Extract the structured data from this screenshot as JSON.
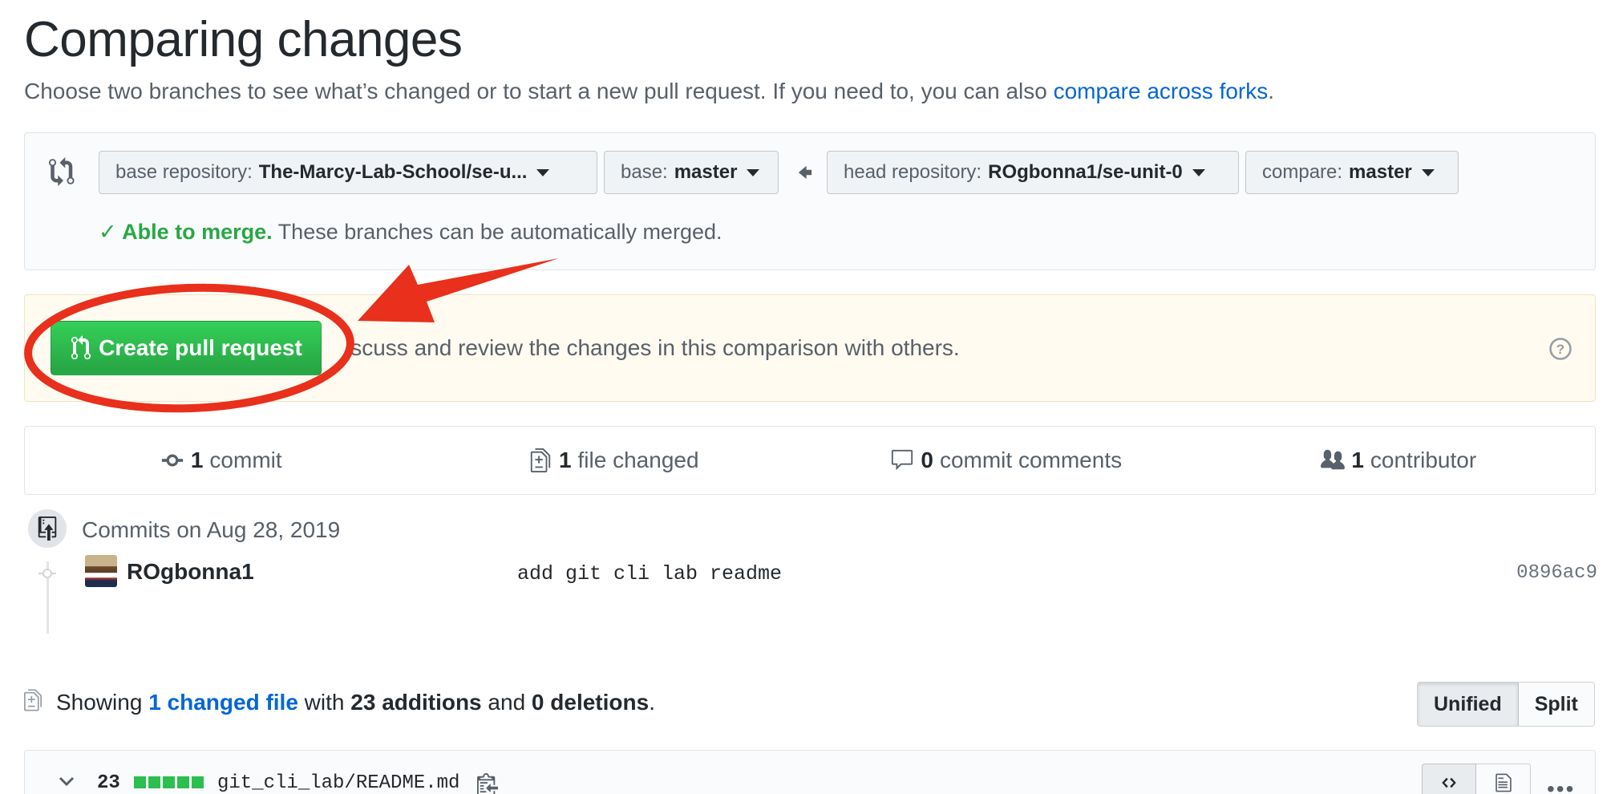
{
  "page": {
    "title": "Comparing changes",
    "subtitle_text": "Choose two branches to see what’s changed or to start a new pull request. If you need to, you can also ",
    "subtitle_link": "compare across forks",
    "subtitle_end": "."
  },
  "range": {
    "base_repo_label": "base repository:",
    "base_repo_value": "The-Marcy-Lab-School/se-u...",
    "base_label": "base:",
    "base_value": "master",
    "head_repo_label": "head repository:",
    "head_repo_value": "ROgbonna1/se-unit-0",
    "compare_label": "compare:",
    "compare_value": "master",
    "merge_ok": "Able to merge.",
    "merge_text": " These branches can be automatically merged."
  },
  "banner": {
    "button_label": "Create pull request",
    "text": "iscuss and review the changes in this comparison with others."
  },
  "summary": {
    "commits_count": "1",
    "commits_label": "commit",
    "files_count": "1",
    "files_label": "file changed",
    "comments_count": "0",
    "comments_label": "commit comments",
    "contributors_count": "1",
    "contributors_label": "contributor"
  },
  "commits": {
    "date": "Commits on Aug 28, 2019",
    "items": [
      {
        "author": "ROgbonna1",
        "message": "add git cli lab readme",
        "sha": "0896ac9"
      }
    ]
  },
  "diffstat": {
    "prefix": "Showing ",
    "link": "1 changed file",
    "mid1": " with ",
    "additions": "23 additions",
    "mid2": " and ",
    "deletions": "0 deletions",
    "end": "."
  },
  "view_toggle": {
    "unified": "Unified",
    "split": "Split"
  },
  "file": {
    "lines": "23",
    "path": "git_cli_lab/README.md"
  },
  "colors": {
    "green": "#28a745",
    "link": "#0366d6",
    "annotation_red": "#e8301c"
  }
}
